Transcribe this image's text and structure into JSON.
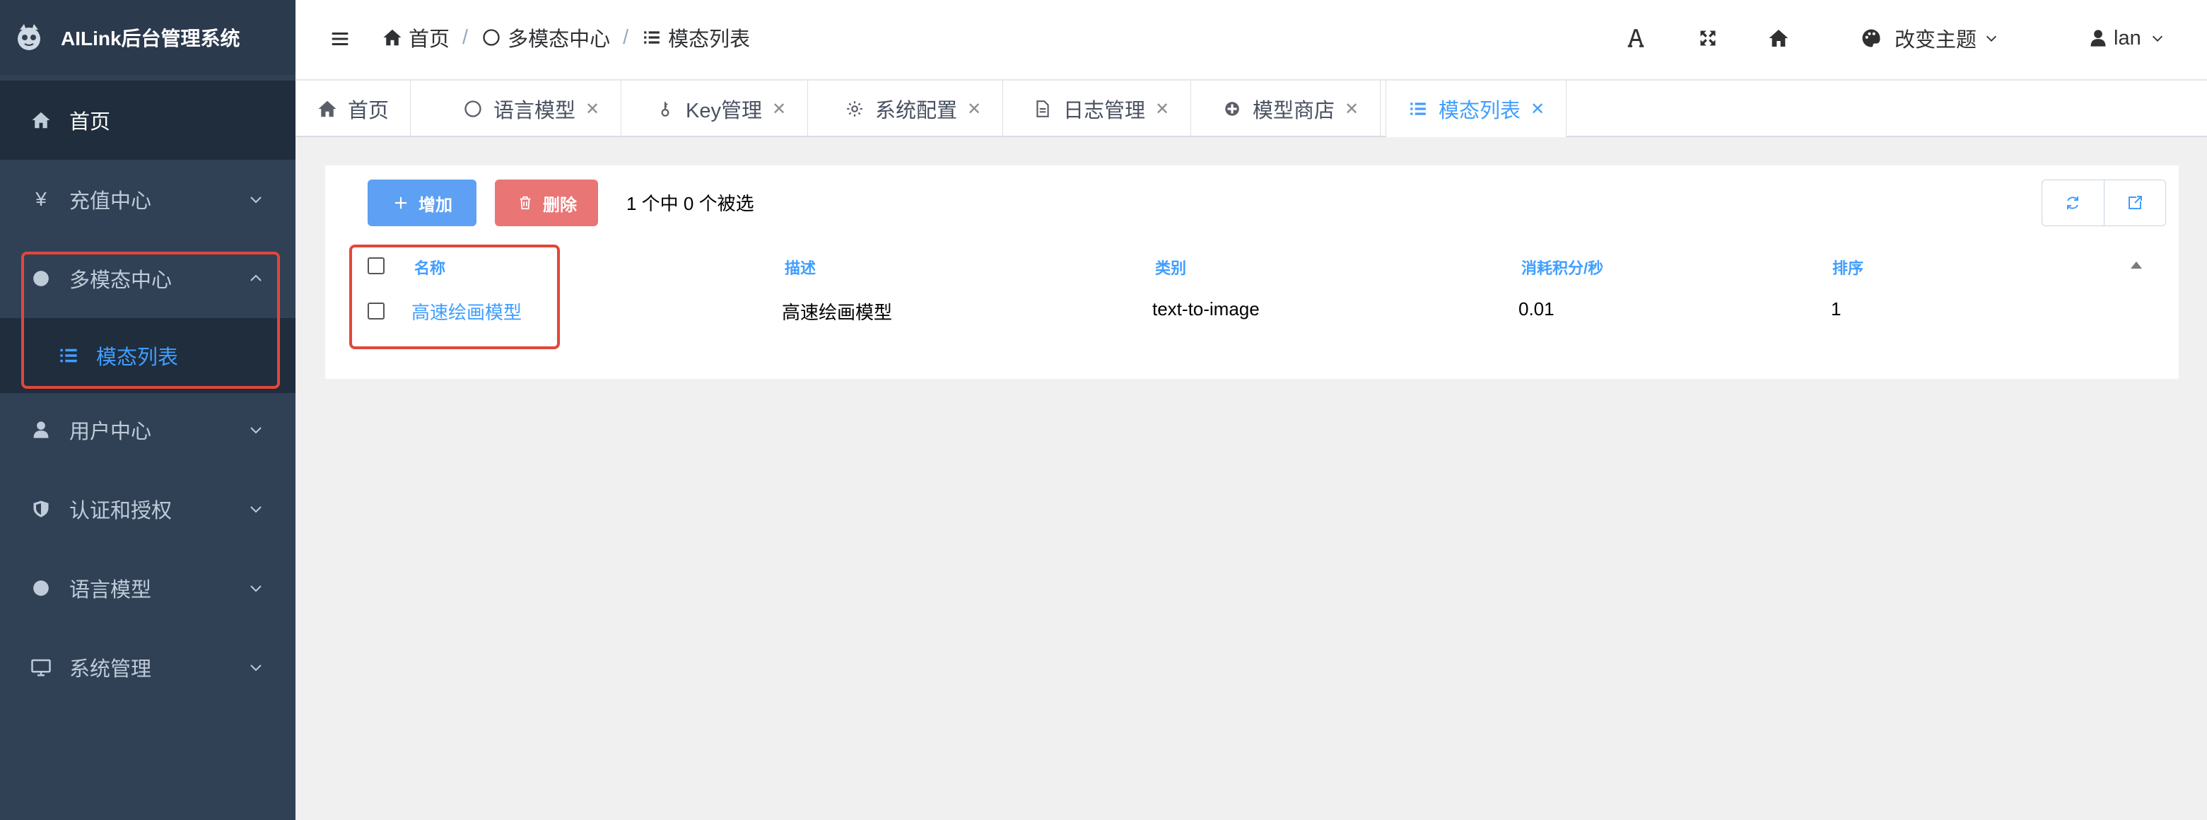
{
  "app": {
    "title": "AILink后台管理系统"
  },
  "sidebar": {
    "items": [
      {
        "label": "首页",
        "icon": "home-icon"
      },
      {
        "label": "充值中心",
        "icon": "yen-icon"
      },
      {
        "label": "多模态中心",
        "icon": "circle-icon",
        "expanded": true,
        "children": [
          {
            "label": "模态列表",
            "icon": "list-icon",
            "active": true
          }
        ]
      },
      {
        "label": "用户中心",
        "icon": "user-icon"
      },
      {
        "label": "认证和授权",
        "icon": "shield-icon"
      },
      {
        "label": "语言模型",
        "icon": "circle-icon"
      },
      {
        "label": "系统管理",
        "icon": "monitor-icon"
      }
    ]
  },
  "header": {
    "breadcrumb": [
      {
        "label": "首页",
        "icon": "home-icon"
      },
      {
        "label": "多模态中心",
        "icon": "circle-outline-icon"
      },
      {
        "label": "模态列表",
        "icon": "list-icon"
      }
    ],
    "separator": "/",
    "theme_label": "改变主题",
    "user_name": "lan"
  },
  "tabs": [
    {
      "label": "首页",
      "icon": "home-icon",
      "closable": false
    },
    {
      "label": "语言模型",
      "icon": "circle-outline-icon",
      "closable": true
    },
    {
      "label": "Key管理",
      "icon": "key-icon",
      "closable": true
    },
    {
      "label": "系统配置",
      "icon": "gear-icon",
      "closable": true
    },
    {
      "label": "日志管理",
      "icon": "document-icon",
      "closable": true
    },
    {
      "label": "模型商店",
      "icon": "store-icon",
      "closable": true
    },
    {
      "label": "模态列表",
      "icon": "list-icon",
      "closable": true,
      "active": true
    }
  ],
  "toolbar": {
    "add_label": "增加",
    "delete_label": "删除",
    "selection_info": "1 个中 0 个被选"
  },
  "table": {
    "columns": [
      "名称",
      "描述",
      "类别",
      "消耗积分/秒",
      "排序"
    ],
    "rows": [
      {
        "name": "高速绘画模型",
        "description": "高速绘画模型",
        "category": "text-to-image",
        "cost": "0.01",
        "order": "1"
      }
    ]
  },
  "colors": {
    "sidebar_bg": "#304156",
    "active_blue": "#409eff",
    "add_button": "#5ea0f4",
    "delete_button": "#ea7575",
    "highlight_red": "#e2473a"
  }
}
